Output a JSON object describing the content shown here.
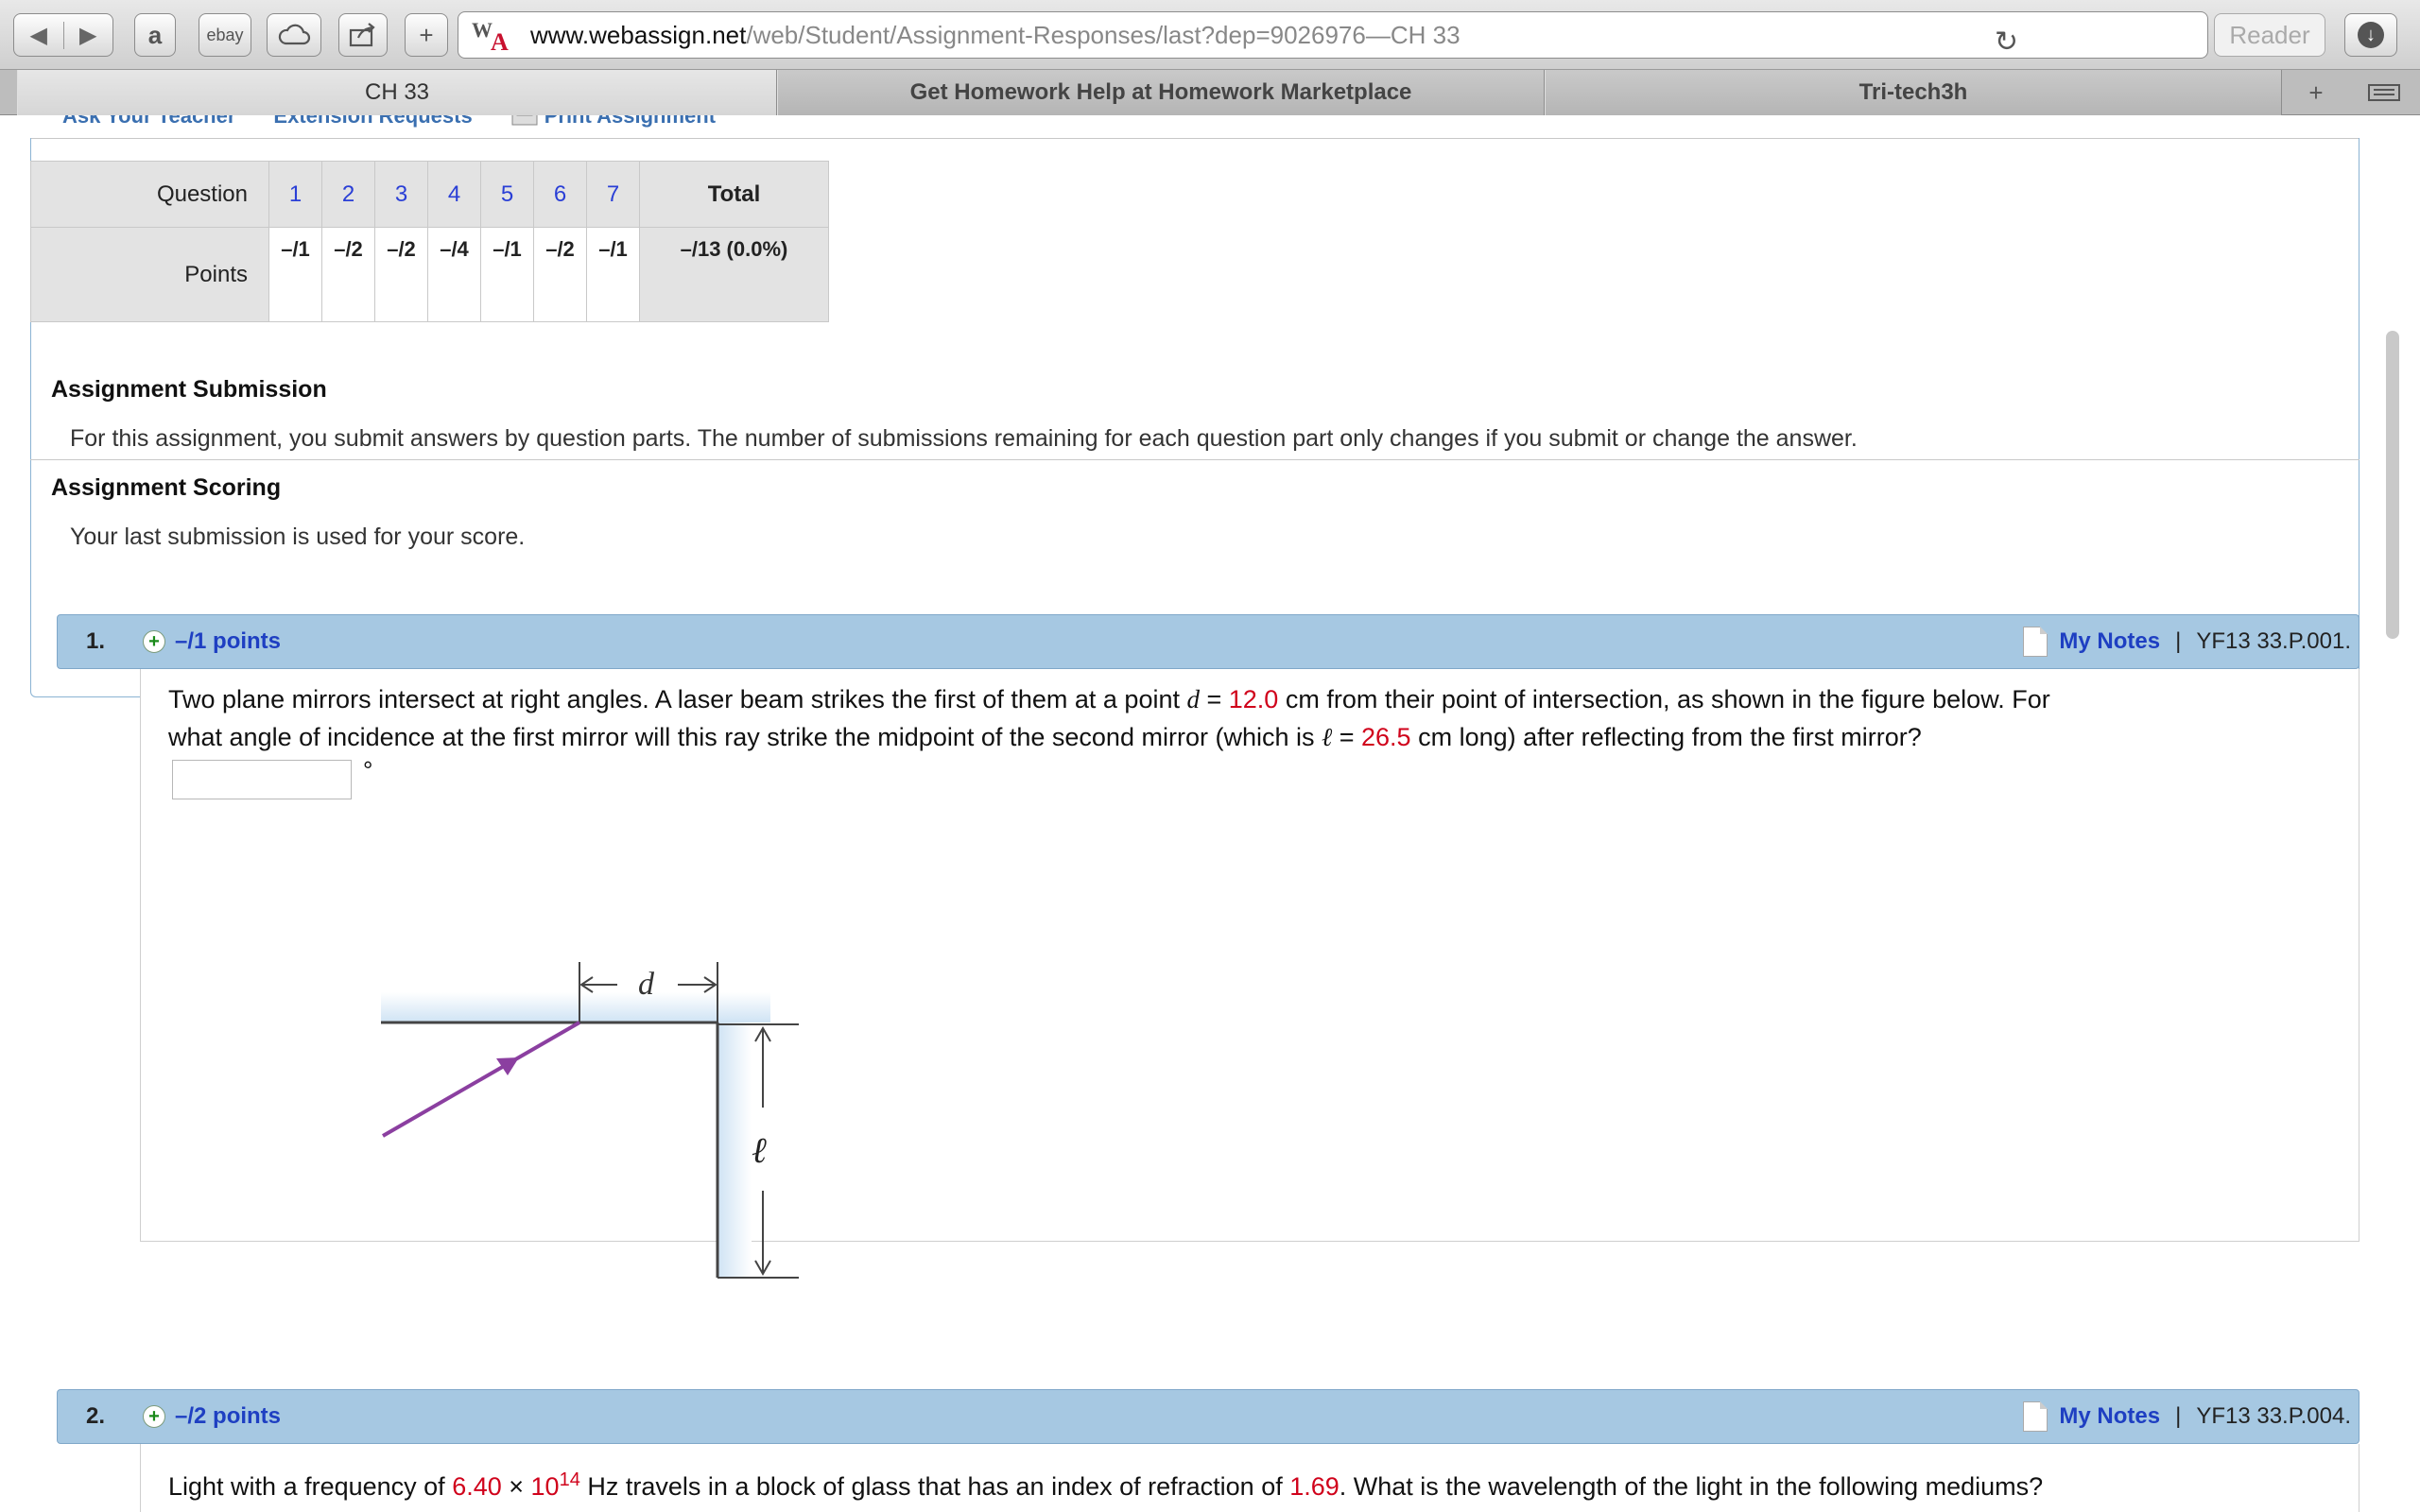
{
  "browser": {
    "url_host": "www.webassign.net",
    "url_path": "/web/Student/Assignment-Responses/last?dep=9026976",
    "url_dash": " — ",
    "page_title": "CH 33",
    "reader_label": "Reader",
    "amazon_label": "a",
    "ebay_label": "ebay",
    "new_tab_label": "+",
    "add_label": "+",
    "icons": {
      "back": "back-arrow-icon",
      "forward": "forward-arrow-icon",
      "amazon": "amazon-icon",
      "ebay": "ebay-icon",
      "cloud": "cloud-icon",
      "share": "share-icon",
      "add": "plus-icon",
      "site": "webassign-logo-icon",
      "reload": "reload-icon",
      "download": "download-icon",
      "tab_list": "tab-list-icon"
    },
    "tabs": [
      {
        "label": "CH 33",
        "active": true
      },
      {
        "label": "Get Homework Help at Homework Marketplace",
        "active": false
      },
      {
        "label": "Tri-tech3h",
        "active": false
      }
    ]
  },
  "topnav": {
    "links": [
      "Ask Your Teacher",
      "Extension Requests",
      "Print Assignment"
    ]
  },
  "score_table": {
    "question_label": "Question",
    "points_label": "Points",
    "total_label": "Total",
    "questions": [
      "1",
      "2",
      "3",
      "4",
      "5",
      "6",
      "7"
    ],
    "points": [
      "–/1",
      "–/2",
      "–/2",
      "–/4",
      "–/1",
      "–/2",
      "–/1"
    ],
    "total_points": "–/13 (0.0%)"
  },
  "submission": {
    "title": "Assignment Submission",
    "text": "For this assignment, you submit answers by question parts. The number of submissions remaining for each question part only changes if you submit or change the answer."
  },
  "scoring": {
    "title": "Assignment Scoring",
    "text": "Your last submission is used for your score."
  },
  "questions": [
    {
      "number": "1.",
      "points": "–/1 points",
      "notes_label": "My Notes",
      "separator": "|",
      "ref": "YF13 33.P.001.",
      "text": {
        "l1a": "Two plane mirrors intersect at right angles. A laser beam strikes the first of them at a point ",
        "var_d": "d",
        "eq1": " = ",
        "val_d": "12.0",
        "l1b": " cm from their point of intersection, as shown in the figure below. For",
        "l2a": "what angle of incidence at the first mirror will this ray strike the midpoint of the second mirror (which is ",
        "var_l": "ℓ",
        "eq2": " = ",
        "val_l": "26.5",
        "l2b": " cm long) after reflecting from the first mirror?"
      },
      "unit": "°",
      "figure": {
        "label_d": "d",
        "label_l": "ℓ"
      }
    },
    {
      "number": "2.",
      "points": "–/2 points",
      "notes_label": "My Notes",
      "separator": "|",
      "ref": "YF13 33.P.004.",
      "text": {
        "a": "Light with a frequency of ",
        "freq": "6.40",
        "times": " × ",
        "base": "10",
        "exp": "14",
        "b": " Hz travels in a block of glass that has an index of refraction of ",
        "n": "1.69",
        "c": ". What is the wavelength of the light in the following mediums?"
      }
    }
  ],
  "colors": {
    "question_header": "#a6c8e2",
    "link_blue": "#1e3fc2",
    "value_red": "#d0021b",
    "ray_purple": "#8b3fa0"
  }
}
